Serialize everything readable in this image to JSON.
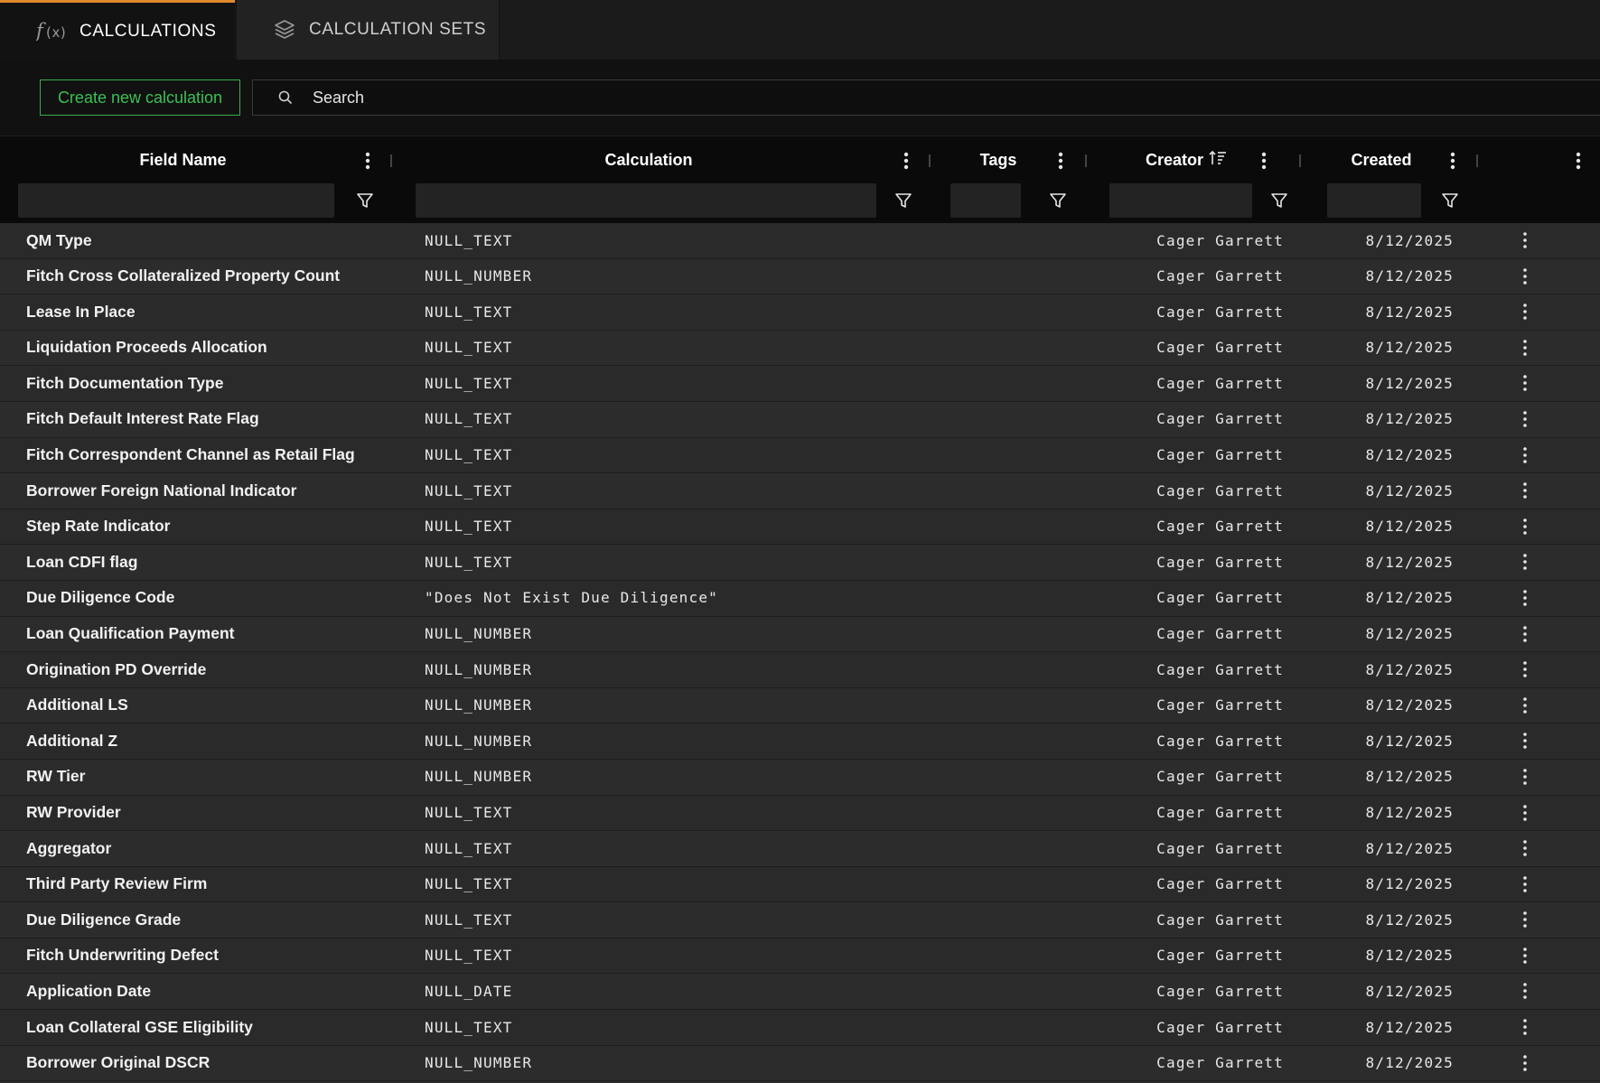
{
  "tabs": [
    {
      "label": "CALCULATIONS",
      "icon": "function-icon",
      "active": true
    },
    {
      "label": "CALCULATION SETS",
      "icon": "layers-icon",
      "active": false
    }
  ],
  "toolbar": {
    "create_label": "Create new calculation",
    "search_placeholder": "Search",
    "accent_color": "#3cc152"
  },
  "columns": {
    "field_name": "Field Name",
    "calculation": "Calculation",
    "tags": "Tags",
    "creator": "Creator",
    "created": "Created"
  },
  "sort": {
    "column": "creator",
    "direction": "ascending"
  },
  "rows": [
    {
      "field_name": "QM Type",
      "calculation": "NULL_TEXT",
      "tags": "",
      "creator": "Cager Garrett",
      "created": "8/12/2025"
    },
    {
      "field_name": "Fitch Cross Collateralized Property Count",
      "calculation": "NULL_NUMBER",
      "tags": "",
      "creator": "Cager Garrett",
      "created": "8/12/2025"
    },
    {
      "field_name": "Lease In Place",
      "calculation": "NULL_TEXT",
      "tags": "",
      "creator": "Cager Garrett",
      "created": "8/12/2025"
    },
    {
      "field_name": "Liquidation Proceeds Allocation",
      "calculation": "NULL_TEXT",
      "tags": "",
      "creator": "Cager Garrett",
      "created": "8/12/2025"
    },
    {
      "field_name": "Fitch Documentation Type",
      "calculation": "NULL_TEXT",
      "tags": "",
      "creator": "Cager Garrett",
      "created": "8/12/2025"
    },
    {
      "field_name": "Fitch Default Interest Rate Flag",
      "calculation": "NULL_TEXT",
      "tags": "",
      "creator": "Cager Garrett",
      "created": "8/12/2025"
    },
    {
      "field_name": "Fitch Correspondent Channel as Retail Flag",
      "calculation": "NULL_TEXT",
      "tags": "",
      "creator": "Cager Garrett",
      "created": "8/12/2025"
    },
    {
      "field_name": "Borrower Foreign National Indicator",
      "calculation": "NULL_TEXT",
      "tags": "",
      "creator": "Cager Garrett",
      "created": "8/12/2025"
    },
    {
      "field_name": "Step Rate Indicator",
      "calculation": "NULL_TEXT",
      "tags": "",
      "creator": "Cager Garrett",
      "created": "8/12/2025"
    },
    {
      "field_name": "Loan CDFI flag",
      "calculation": "NULL_TEXT",
      "tags": "",
      "creator": "Cager Garrett",
      "created": "8/12/2025"
    },
    {
      "field_name": "Due Diligence Code",
      "calculation": "\"Does Not Exist Due Diligence\"",
      "tags": "",
      "creator": "Cager Garrett",
      "created": "8/12/2025"
    },
    {
      "field_name": "Loan Qualification Payment",
      "calculation": "NULL_NUMBER",
      "tags": "",
      "creator": "Cager Garrett",
      "created": "8/12/2025"
    },
    {
      "field_name": "Origination PD Override",
      "calculation": "NULL_NUMBER",
      "tags": "",
      "creator": "Cager Garrett",
      "created": "8/12/2025"
    },
    {
      "field_name": "Additional LS",
      "calculation": "NULL_NUMBER",
      "tags": "",
      "creator": "Cager Garrett",
      "created": "8/12/2025"
    },
    {
      "field_name": "Additional Z",
      "calculation": "NULL_NUMBER",
      "tags": "",
      "creator": "Cager Garrett",
      "created": "8/12/2025"
    },
    {
      "field_name": "RW Tier",
      "calculation": "NULL_NUMBER",
      "tags": "",
      "creator": "Cager Garrett",
      "created": "8/12/2025"
    },
    {
      "field_name": "RW Provider",
      "calculation": "NULL_TEXT",
      "tags": "",
      "creator": "Cager Garrett",
      "created": "8/12/2025"
    },
    {
      "field_name": "Aggregator",
      "calculation": "NULL_TEXT",
      "tags": "",
      "creator": "Cager Garrett",
      "created": "8/12/2025"
    },
    {
      "field_name": "Third Party Review Firm",
      "calculation": "NULL_TEXT",
      "tags": "",
      "creator": "Cager Garrett",
      "created": "8/12/2025"
    },
    {
      "field_name": "Due Diligence Grade",
      "calculation": "NULL_TEXT",
      "tags": "",
      "creator": "Cager Garrett",
      "created": "8/12/2025"
    },
    {
      "field_name": "Fitch Underwriting Defect",
      "calculation": "NULL_TEXT",
      "tags": "",
      "creator": "Cager Garrett",
      "created": "8/12/2025"
    },
    {
      "field_name": "Application Date",
      "calculation": "NULL_DATE",
      "tags": "",
      "creator": "Cager Garrett",
      "created": "8/12/2025"
    },
    {
      "field_name": "Loan Collateral GSE Eligibility",
      "calculation": "NULL_TEXT",
      "tags": "",
      "creator": "Cager Garrett",
      "created": "8/12/2025"
    },
    {
      "field_name": "Borrower Original DSCR",
      "calculation": "NULL_NUMBER",
      "tags": "",
      "creator": "Cager Garrett",
      "created": "8/12/2025"
    }
  ]
}
